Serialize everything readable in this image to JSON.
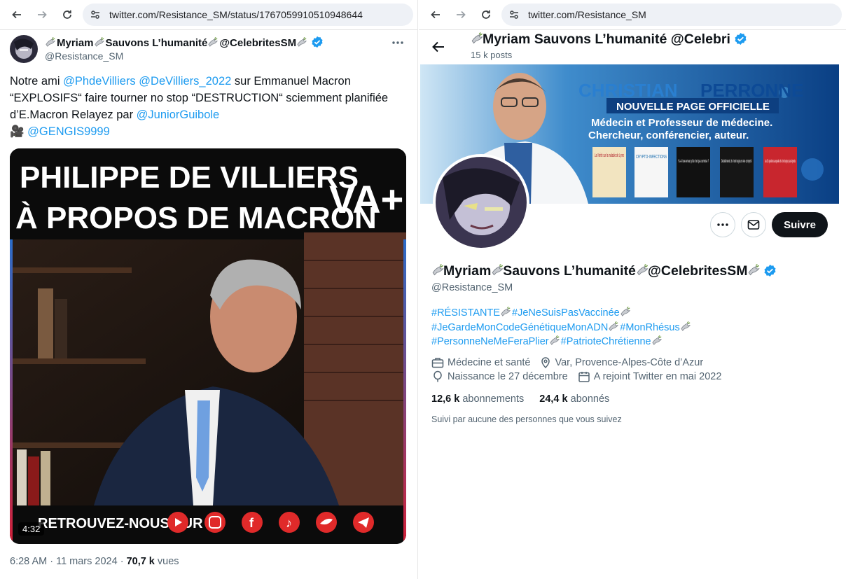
{
  "left_browser": {
    "url": "twitter.com/Resistance_SM/status/1767059910510948644"
  },
  "right_browser": {
    "url": "twitter.com/Resistance_SM"
  },
  "tweet": {
    "author_name_parts": [
      "Myriam",
      "Sauvons L’humanité",
      "@CelebritesSM"
    ],
    "handle": "@Resistance_SM",
    "text_intro": "Notre ami ",
    "mention1": "@PhdeVilliers",
    "mention2": "@DeVilliers_2022",
    "text_mid": " sur Emmanuel Macron “EXPLOSIFS“ faire tourner no stop “DESTRUCTION“ sciemment planifiée d’E.Macron Relayez par ",
    "mention3": "@JuniorGuibole",
    "camera_emoji": "🎥",
    "mention4": "@GENGIS9999",
    "video": {
      "title_line1": "PHILIPPE DE VILLIERS",
      "title_line2": "À PROPOS DE MACRON",
      "logo": "VA+",
      "footer": "RETROUVEZ-NOUS SUR",
      "duration": "4:32",
      "social_icons": [
        "youtube-icon",
        "instagram-icon",
        "facebook-icon",
        "tiktok-icon",
        "twitter-icon",
        "telegram-icon"
      ]
    },
    "time": "6:28 AM · 11 mars 2024 · ",
    "views_count": "70,7 k",
    "views_label": " vues"
  },
  "profile": {
    "header_name": "Myriam Sauvons L’humanité @Celebri",
    "posts": "15 k posts",
    "banner": {
      "name_first": "CHRISTIAN",
      "name_last": "PERRONNE",
      "subtitle": "NOUVELLE PAGE OFFICIELLE",
      "desc_line1": "Médecin et Professeur de médecine.",
      "desc_line2": "Chercheur, conférencier, auteur.",
      "books": [
        "La Vérité sur la maladie de Lyme",
        "CRYPTO-INFECTIONS",
        "Y a-t-il une erreur qu'ils n'ont pas commise ?",
        "Décidément, ils n'ont toujours rien compris !",
        "Les 33 questions auxquelles ils n'ont toujours pas répondu"
      ]
    },
    "follow_label": "Suivre",
    "name_parts": [
      "Myriam",
      "Sauvons L’humanité",
      "@CelebritesSM"
    ],
    "handle": "@Resistance_SM",
    "bio_tags": [
      "#RÉSISTANTE",
      "#JeNeSuisPasVaccinée",
      "#JeGardeMonCodeGénétiqueMonADN",
      "#MonRhésus",
      "#PersonneNeMeFeraPlier",
      "#PatrioteChrétienne"
    ],
    "category": "Médecine et santé",
    "location": "Var, Provence-Alpes-Côte d’Azur",
    "birthday": "Naissance le 27 décembre",
    "joined": "A rejoint Twitter en mai 2022",
    "following_count": "12,6 k",
    "following_label": "abonnements",
    "followers_count": "24,4 k",
    "followers_label": "abonnés",
    "followed_by": "Suivi par aucune des personnes que vous suivez"
  },
  "colors": {
    "accent": "#1d9bf0",
    "text": "#0f1419",
    "muted": "#536471",
    "banner_blue": "#0a4a8c"
  }
}
